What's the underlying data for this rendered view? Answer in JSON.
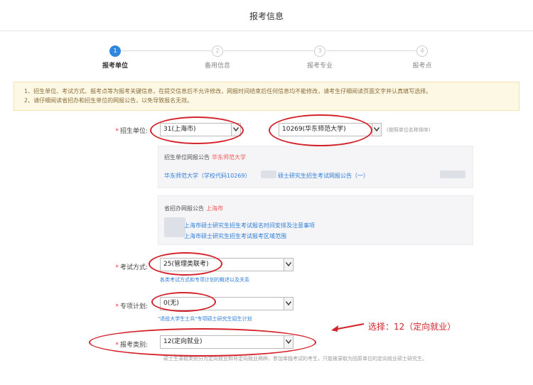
{
  "header": {
    "title": "报考信息"
  },
  "steps": [
    {
      "number": "1",
      "label": "报考单位",
      "active": true
    },
    {
      "number": "2",
      "label": "备用信息",
      "active": false
    },
    {
      "number": "3",
      "label": "报考专业",
      "active": false
    },
    {
      "number": "4",
      "label": "报考点",
      "active": false
    }
  ],
  "notice": {
    "line1": "1、招生单位、考试方式、报考点等为报考关键信息，在提交信息后不允许修改，网报时间结束后任何信息均不能修改，请考生仔细阅读页面文字并认真填写选择。",
    "line2": "2、请仔细阅读省招办和招生单位的网报公告，以免导致报名无效。"
  },
  "form": {
    "unit": {
      "label": "招生单位:",
      "province_value": "31(上海市)",
      "school_value": "10269(华东师范大学)",
      "sort_hint": "(按照单位名称排序)"
    },
    "unit_notice": {
      "title": "招生单位网报公告",
      "school": "华东师范大学",
      "link": "华东师范大学（学校代码10269）",
      "link_tail": "硕士研究生招生考试网报公告（一）"
    },
    "province_notice": {
      "title": "省招办网报公告",
      "province": "上海市",
      "link1": "上海市硕士研究生招生考试报名时间安排及注意事项",
      "link2": "上海市硕士研究生招生考试报考区域范围"
    },
    "exam_method": {
      "label": "考试方式:",
      "value": "25(管理类联考)",
      "hint": "各类考试方式和专项计划的概述以及关系"
    },
    "special_plan": {
      "label": "专项计划:",
      "value": "0(无)",
      "hint": "\"退役大学生士兵\"专项硕士研究生招生计划"
    },
    "category": {
      "label": "报考类别:",
      "value": "12(定向就业)",
      "hint": "硕士生录取类别分为定向就业和非定向就业两种，参加单独考试的考生，只能被录取为回原单位的定向就业硕士研究生。"
    }
  },
  "annotation": {
    "text": "选择：12（定向就业）"
  },
  "colors": {
    "accent": "#2e86de",
    "annotation_red": "#d4232b",
    "notice_bg": "#fdf8e4"
  }
}
